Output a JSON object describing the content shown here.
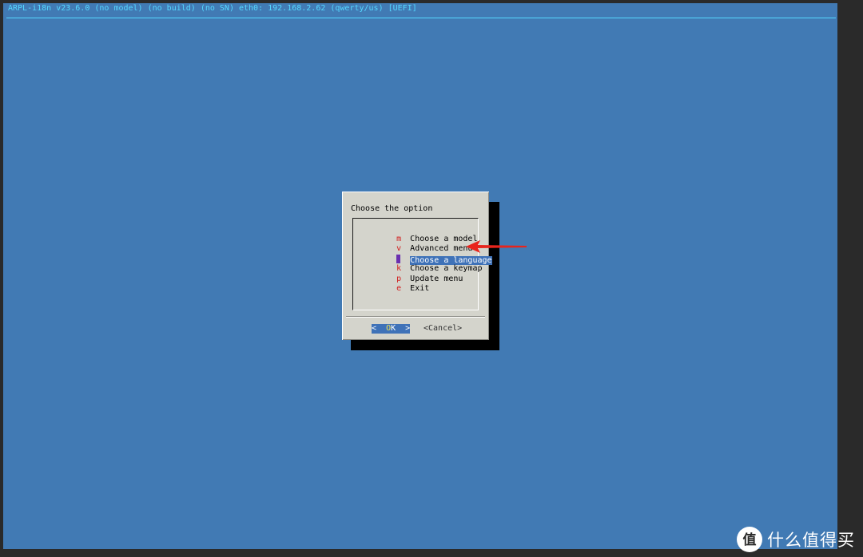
{
  "backtitle": "ARPL-i18n v23.6.0 (no model) (no build) (no SN) eth0: 192.168.2.62 (qwerty/us) [UEFI]",
  "dialog": {
    "title": "Choose the option",
    "items": [
      {
        "key": "m",
        "label": "Choose a model"
      },
      {
        "key": "v",
        "label": "Advanced menu"
      },
      {
        "key": "l",
        "label": "Choose a language",
        "selected": true
      },
      {
        "key": "k",
        "label": "Choose a keymap"
      },
      {
        "key": "p",
        "label": "Update menu"
      },
      {
        "key": "e",
        "label": "Exit"
      }
    ],
    "ok_button": {
      "left": "<  ",
      "hot": "O",
      "rest": "K",
      "right": "  >"
    },
    "cancel_button": "<Cancel>"
  },
  "watermark": {
    "logo_text": "值",
    "text": "什么值得买"
  },
  "colors": {
    "screen_bg": "#417ab4",
    "backtitle": "#55d8ff",
    "dialog_bg": "#d4d4cc",
    "highlight": "#3f72b8",
    "hotkey": "#d11a1a",
    "annotation_arrow": "#e8241c"
  }
}
